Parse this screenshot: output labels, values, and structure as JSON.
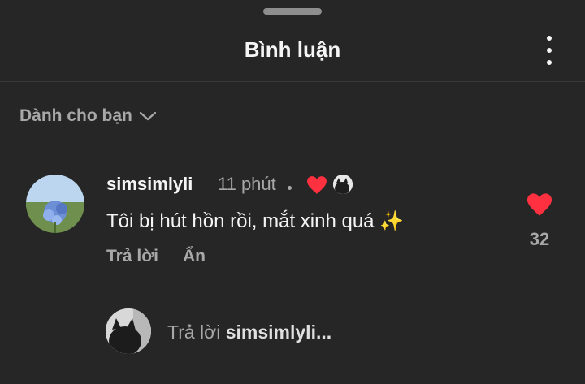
{
  "header": {
    "title": "Bình luận",
    "more_icon": "more-vertical-icon"
  },
  "filter": {
    "label": "Dành cho bạn",
    "icon": "chevron-down-icon"
  },
  "comment": {
    "username": "simsimlyli",
    "time": "11 phút",
    "text": "Tôi bị hút hồn rồi, mắt xinh quá ✨",
    "reply_label": "Trả lời",
    "hide_label": "Ẩn",
    "like_count": "32",
    "colors": {
      "heart": "#ff3040",
      "muted": "#a8a8a8"
    }
  },
  "reply_box": {
    "prefix": "Trả lời",
    "target": "simsimlyli..."
  }
}
